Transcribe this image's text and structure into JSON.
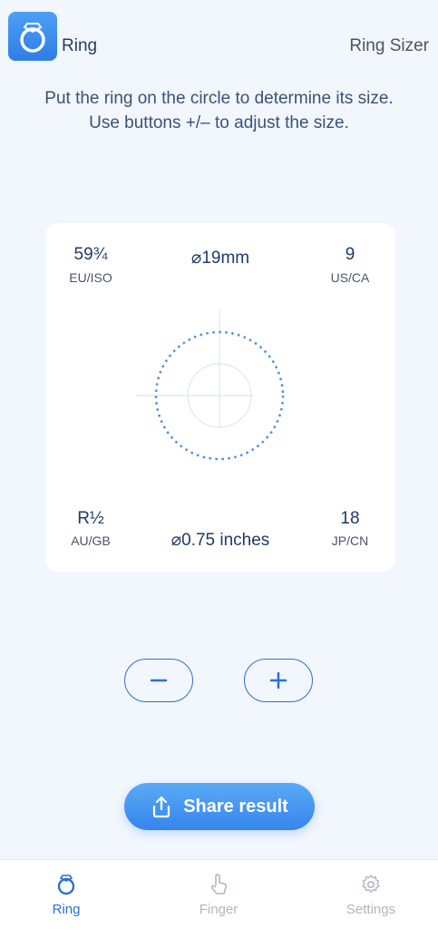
{
  "header": {
    "app_name": "Ring",
    "title": "Ring Sizer"
  },
  "instructions": {
    "line1": "Put the ring on the circle to determine its size.",
    "line2": "Use buttons +/– to adjust the size."
  },
  "sizes": {
    "eu_value": "59¾",
    "eu_label": "EU/ISO",
    "us_value": "9",
    "us_label": "US/CA",
    "au_value": "R½",
    "au_label": "AU/GB",
    "jp_value": "18",
    "jp_label": "JP/CN",
    "diameter_mm": "⌀19mm",
    "diameter_in": "⌀0.75 inches"
  },
  "controls": {
    "minus_label": "−",
    "plus_label": "+"
  },
  "share": {
    "label": "Share result"
  },
  "tabs": [
    {
      "label": "Ring",
      "icon": "ring-icon",
      "active": true
    },
    {
      "label": "Finger",
      "icon": "finger-icon",
      "active": false
    },
    {
      "label": "Settings",
      "icon": "gear-icon",
      "active": false
    }
  ],
  "colors": {
    "accent": "#2f6fd0",
    "inactive": "#b0b6bf",
    "background": "#f2f6fd"
  }
}
